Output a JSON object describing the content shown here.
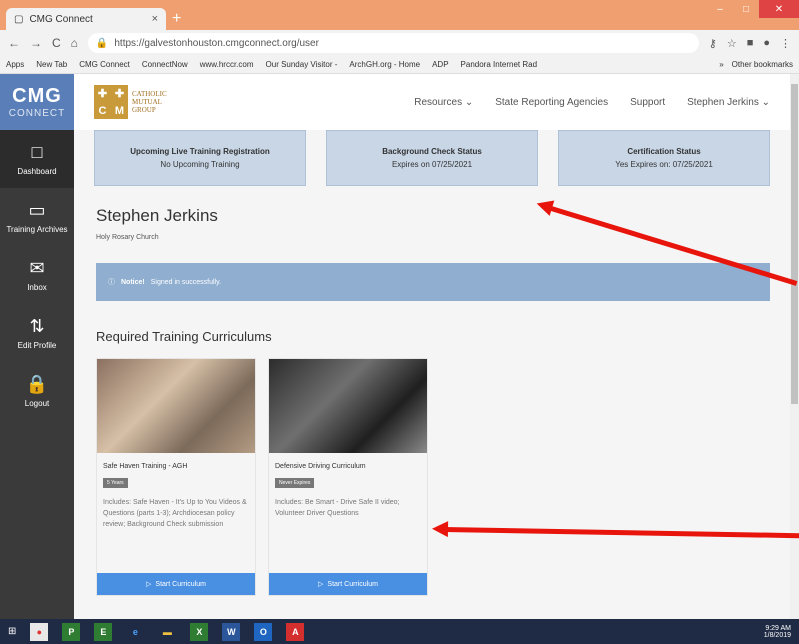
{
  "browser": {
    "tab_title": "CMG Connect",
    "tab_close": "×",
    "new_tab": "+",
    "url": "https://galvestonhouston.cmgconnect.org/user",
    "bookmarks": [
      "Apps",
      "New Tab",
      "CMG Connect",
      "ConnectNow",
      "www.hrccr.com",
      "Our Sunday Visitor -",
      "ArchGH.org - Home",
      "ADP",
      "Pandora Internet Rad"
    ],
    "other_bookmarks": "Other bookmarks",
    "chevron": "»"
  },
  "sidebar": {
    "logo_top": "CMG",
    "logo_bottom": "CONNECT",
    "items": [
      {
        "label": "Dashboard",
        "icon": "□"
      },
      {
        "label": "Training Archives",
        "icon": "▭"
      },
      {
        "label": "Inbox",
        "icon": "✉"
      },
      {
        "label": "Edit Profile",
        "icon": "⇅"
      },
      {
        "label": "Logout",
        "icon": "🔒"
      }
    ]
  },
  "header": {
    "brand": {
      "line1": "CATHOLIC",
      "line2": "MUTUAL",
      "line3": "GROUP"
    },
    "nav": [
      "Resources ⌄",
      "State Reporting Agencies",
      "Support",
      "Stephen Jerkins ⌄"
    ]
  },
  "cards": [
    {
      "title": "Upcoming Live Training Registration",
      "value": "No Upcoming Training"
    },
    {
      "title": "Background Check Status",
      "value": "Expires on 07/25/2021"
    },
    {
      "title": "Certification Status",
      "value": "Yes Expires on: 07/25/2021"
    }
  ],
  "user": {
    "name": "Stephen Jerkins",
    "parish": "Holy Rosary Church"
  },
  "notice": {
    "label": "Notice!",
    "message": "Signed in successfully."
  },
  "section_title": "Required Training Curriculums",
  "curriculums": [
    {
      "name": "Safe Haven Training - AGH",
      "badge": "5 Years",
      "desc": "Includes: Safe Haven - It's Up to You Videos & Questions (parts 1-3); Archdiocesan policy review; Background Check submission",
      "button": "Start Curriculum"
    },
    {
      "name": "Defensive Driving Curriculum",
      "badge": "Never Expires",
      "desc": "Includes: Be Smart - Drive Safe II video; Volunteer Driver Questions",
      "button": "Start Curriculum"
    }
  ],
  "taskbar": {
    "time": "9:29 AM",
    "date": "1/8/2019"
  },
  "colors": {
    "accent": "#4a90e2",
    "sidebar": "#3a3a3a",
    "arrow": "#e8150d"
  }
}
